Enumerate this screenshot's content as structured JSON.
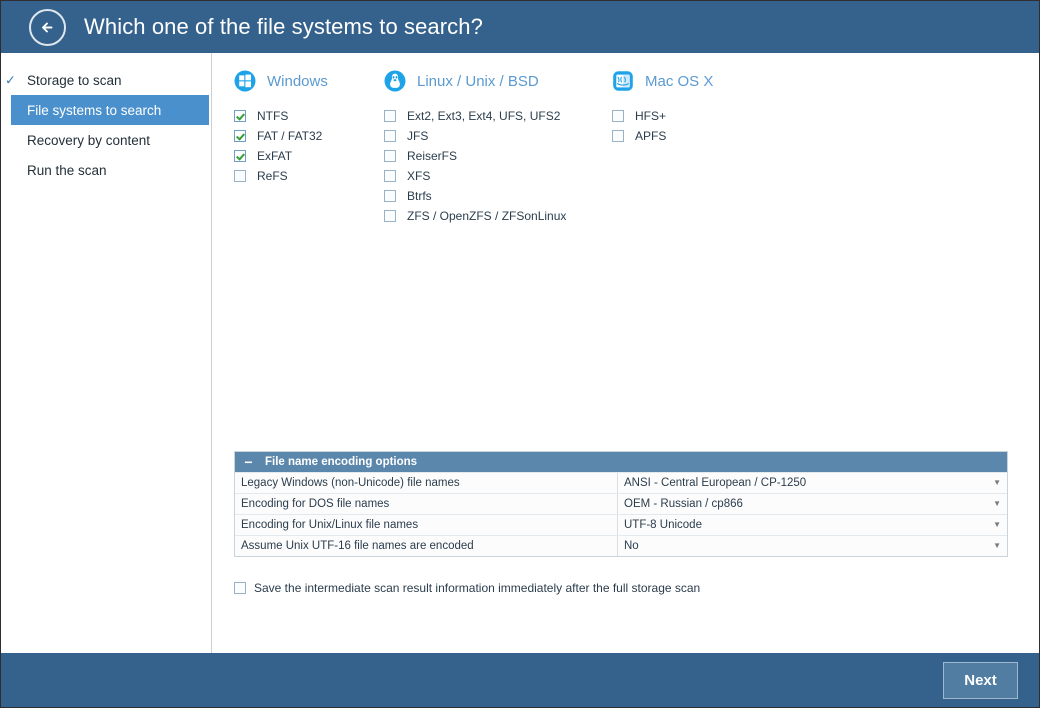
{
  "header": {
    "title": "Which one of the file systems to search?",
    "back_icon": "arrow-left-icon"
  },
  "sidebar": {
    "items": [
      {
        "label": "Storage to scan",
        "state": "completed",
        "check": "✓"
      },
      {
        "label": "File systems to search",
        "state": "active"
      },
      {
        "label": "Recovery by content",
        "state": "pending"
      },
      {
        "label": "Run the scan",
        "state": "pending"
      }
    ]
  },
  "filesystem_groups": [
    {
      "title": "Windows",
      "icon": "windows-logo-icon",
      "items": [
        {
          "label": "NTFS",
          "checked": true
        },
        {
          "label": "FAT / FAT32",
          "checked": true
        },
        {
          "label": "ExFAT",
          "checked": true
        },
        {
          "label": "ReFS",
          "checked": false
        }
      ]
    },
    {
      "title": "Linux / Unix / BSD",
      "icon": "linux-penguin-icon",
      "items": [
        {
          "label": "Ext2, Ext3, Ext4, UFS, UFS2",
          "checked": false
        },
        {
          "label": "JFS",
          "checked": false
        },
        {
          "label": "ReiserFS",
          "checked": false
        },
        {
          "label": "XFS",
          "checked": false
        },
        {
          "label": "Btrfs",
          "checked": false
        },
        {
          "label": "ZFS / OpenZFS / ZFSonLinux",
          "checked": false
        }
      ]
    },
    {
      "title": "Mac OS X",
      "icon": "mac-finder-icon",
      "items": [
        {
          "label": "HFS+",
          "checked": false
        },
        {
          "label": "APFS",
          "checked": false
        }
      ]
    }
  ],
  "encoding_panel": {
    "title": "File name encoding options",
    "collapse_icon": "minus-icon",
    "collapsed": false,
    "rows": [
      {
        "label": "Legacy Windows (non-Unicode) file names",
        "value": "ANSI - Central European / CP-1250",
        "arrow": "▼"
      },
      {
        "label": "Encoding for DOS file names",
        "value": "OEM - Russian / cp866",
        "arrow": "▼"
      },
      {
        "label": "Encoding for Unix/Linux file names",
        "value": "UTF-8 Unicode",
        "arrow": "▼"
      },
      {
        "label": "Assume Unix UTF-16 file names are encoded",
        "value": "No",
        "arrow": "▼"
      }
    ]
  },
  "save_option": {
    "label": "Save the intermediate scan result information immediately after the full storage scan",
    "checked": false
  },
  "footer": {
    "next_label": "Next"
  },
  "colors": {
    "header_blue": "#35628c",
    "accent_blue": "#4a90cd",
    "group_title_blue": "#5b9ad0",
    "panel_header_blue": "#5b87ad",
    "check_green": "#35a035",
    "button_blue": "#527da3"
  }
}
